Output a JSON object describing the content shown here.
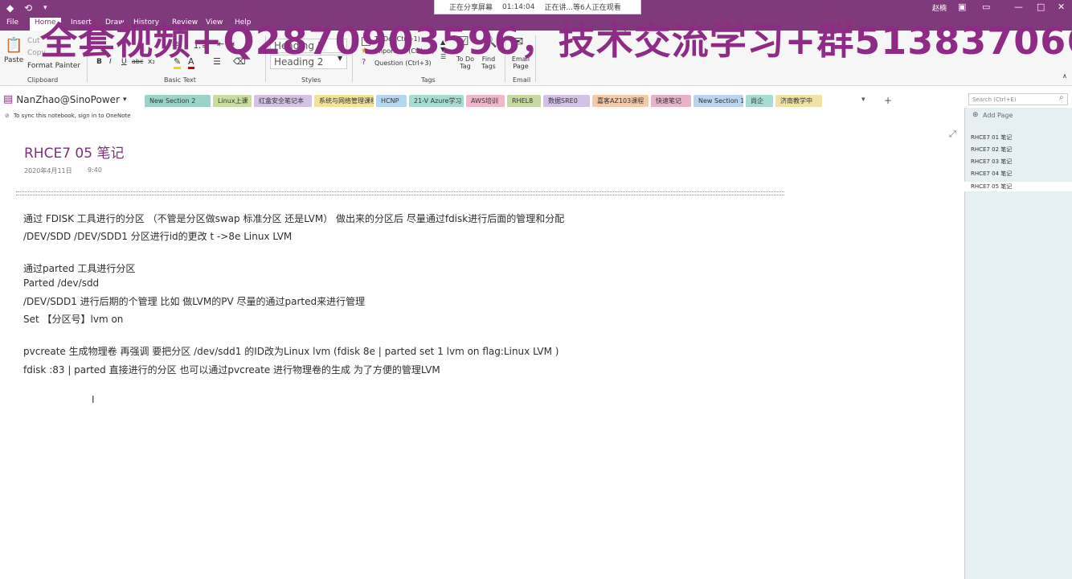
{
  "titlebar": {
    "share_label": "正在分享屏幕",
    "share_time": "01:14:04",
    "share_status": "正在讲...等6人正在观看",
    "user": "赵楠",
    "colors": {
      "brand": "#80397B"
    }
  },
  "menu": [
    "File",
    "Home",
    "Insert",
    "Draw",
    "History",
    "Review",
    "View",
    "Help"
  ],
  "watermark": "全套视频+Q2870903596，技术交流学习+群513837066",
  "ribbon": {
    "clipboard": {
      "paste": "Paste",
      "cut": "Cut",
      "copy": "Copy",
      "format_painter": "Format Painter",
      "label": "Clipboard"
    },
    "basic_text": {
      "bold": "B",
      "italic": "I",
      "underline": "U",
      "strike": "abc",
      "sub": "x₂",
      "font_color": "A",
      "label": "Basic Text"
    },
    "styles": {
      "h1": "Heading 1",
      "h2": "Heading 2",
      "label": "Styles"
    },
    "tags": {
      "todo": "To Do (Ctrl+1)",
      "important": "Important (Ctrl+2)",
      "question": "Question (Ctrl+3)",
      "todo_tag": "To Do Tag",
      "find_tags": "Find Tags",
      "label": "Tags"
    },
    "email": {
      "btn": "Email Page",
      "label": "Email"
    }
  },
  "notebook": {
    "name": "NanZhao@SinoPower"
  },
  "tabs": [
    {
      "label": "New Section 2",
      "color": "#9BD3C8"
    },
    {
      "label": "Linux上课",
      "color": "#C9DDA0"
    },
    {
      "label": "红盒安全笔记本",
      "color": "#D6C1E6"
    },
    {
      "label": "系统与网络管理课程",
      "color": "#F2E39B"
    },
    {
      "label": "HCNP",
      "color": "#B3D7F0"
    },
    {
      "label": "21-V Azure学习",
      "color": "#A7DDD1"
    },
    {
      "label": "AWS培训",
      "color": "#EFB8C8"
    },
    {
      "label": "RHEL8",
      "color": "#C7D8A0"
    },
    {
      "label": "数据SRE0",
      "color": "#D3C2E6"
    },
    {
      "label": "嘉客AZ103课程",
      "color": "#F6C9A8"
    },
    {
      "label": "快速笔记",
      "color": "#E8B2C8"
    },
    {
      "label": "New Section 1",
      "color": "#B8D4EE"
    },
    {
      "label": "尚企",
      "color": "#A7DDD1"
    },
    {
      "label": "济南教学中",
      "color": "#EEE2A4"
    }
  ],
  "search": {
    "placeholder": "Search (Ctrl+E)"
  },
  "info": {
    "text": "To sync this notebook, sign in to OneNote"
  },
  "page": {
    "title": "RHCE7 05 笔记",
    "date": "2020年4月11日",
    "time": "9:40",
    "lines": [
      "通过 FDISK 工具进行的分区 （不管是分区做swap 标准分区 还是LVM） 做出来的分区后 尽量通过fdisk进行后面的管理和分配",
      "/DEV/SDD /DEV/SDD1 分区进行id的更改 t ->8e Linux LVM",
      "通过parted 工具进行分区",
      "Parted /dev/sdd",
      "/DEV/SDD1 进行后期的个管理 比如 做LVM的PV 尽量的通过parted来进行管理",
      "Set 【分区号】lvm on",
      "pvcreate 生成物理卷    再强调 要把分区 /dev/sdd1 的ID改为Linux lvm (fdisk 8e | parted set 1 lvm on  flag:Linux LVM )",
      "fdisk :83 |  parted 直接进行的分区 也可以通过pvcreate 进行物理卷的生成 为了方便的管理LVM"
    ]
  },
  "pages_panel": {
    "add_page": "Add Page",
    "items": [
      "RHCE7 01 笔记",
      "RHCE7 02 笔记",
      "RHCE7 03 笔记",
      "RHCE7 04 笔记",
      "RHCE7 05 笔记"
    ]
  }
}
